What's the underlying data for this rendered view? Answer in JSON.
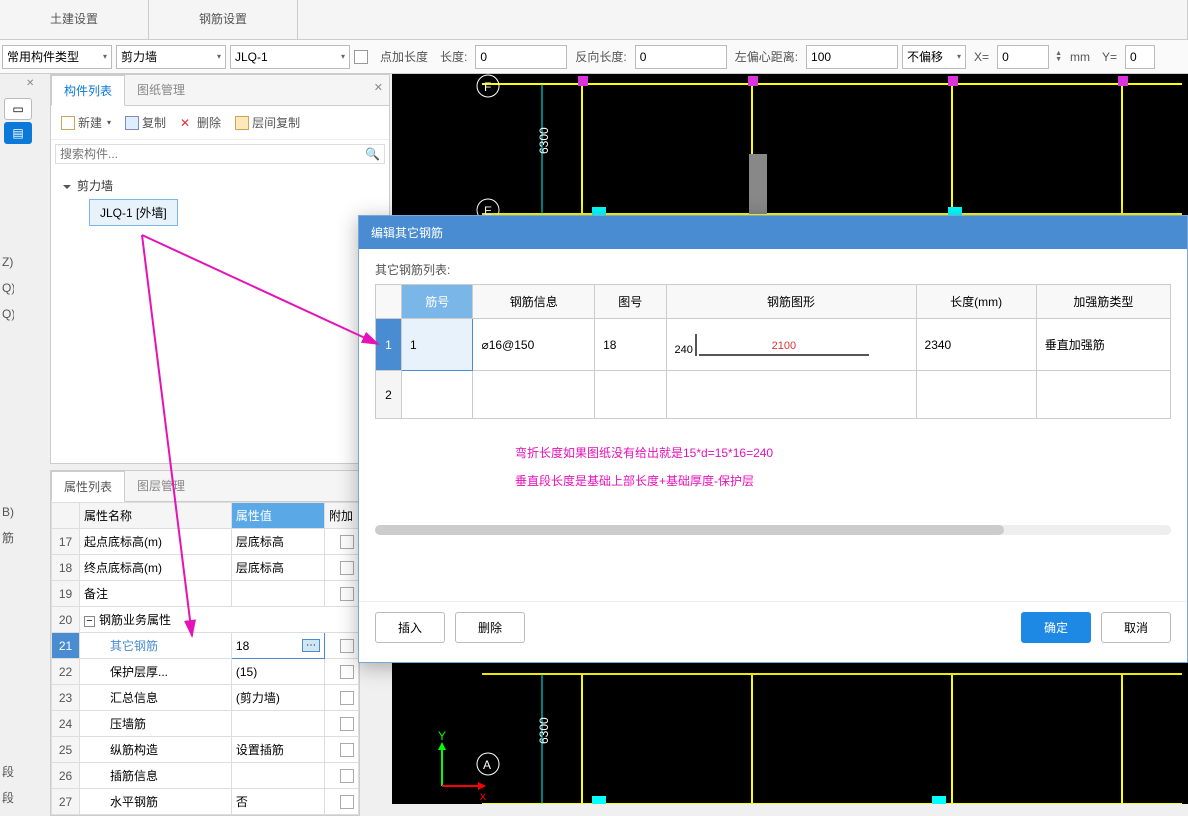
{
  "topbar": {
    "tabs": [
      "土建设置",
      "钢筋设置"
    ]
  },
  "params": {
    "type_label": "常用构件类型",
    "combo1": "剪力墙",
    "combo2": "JLQ-1",
    "pt_len_label": "点加长度",
    "len_label": "长度:",
    "len_val": "0",
    "rev_label": "反向长度:",
    "rev_val": "0",
    "left_ecc_label": "左偏心距离:",
    "left_ecc_val": "100",
    "offset_combo": "不偏移",
    "x_label": "X=",
    "x_val": "0",
    "mm_label": "mm",
    "y_label": "Y=",
    "y_val": "0"
  },
  "side_items": [
    "Z)",
    "Q)",
    "Q)",
    "B)",
    "筋(S)",
    "段(R)",
    "段(R)"
  ],
  "panel": {
    "tabs": [
      "构件列表",
      "图纸管理"
    ],
    "btn_new": "新建",
    "btn_copy": "复制",
    "btn_del": "删除",
    "btn_floor": "层间复制",
    "search_ph": "搜索构件...",
    "search_icon": "🔍",
    "tree_root": "剪力墙",
    "tree_child": "JLQ-1 [外墙]"
  },
  "props": {
    "tabs": [
      "属性列表",
      "图层管理"
    ],
    "hdr_name": "属性名称",
    "hdr_val": "属性值",
    "hdr_extra": "附加",
    "rows": [
      {
        "n": "17",
        "name": "起点底标高(m)",
        "val": "层底标高"
      },
      {
        "n": "18",
        "name": "终点底标高(m)",
        "val": "层底标高"
      },
      {
        "n": "19",
        "name": "备注",
        "val": ""
      },
      {
        "n": "20",
        "name": "钢筋业务属性",
        "val": "",
        "group": true
      },
      {
        "n": "21",
        "name": "其它钢筋",
        "val": "18",
        "sel": true
      },
      {
        "n": "22",
        "name": "保护层厚...",
        "val": "(15)"
      },
      {
        "n": "23",
        "name": "汇总信息",
        "val": "(剪力墙)"
      },
      {
        "n": "24",
        "name": "压墙筋",
        "val": ""
      },
      {
        "n": "25",
        "name": "纵筋构造",
        "val": "设置插筋"
      },
      {
        "n": "26",
        "name": "插筋信息",
        "val": ""
      },
      {
        "n": "27",
        "name": "水平钢筋",
        "val": "否"
      }
    ]
  },
  "cad": {
    "dim": "6300",
    "axis_f": "F",
    "axis_e": "E",
    "axis_a": "A",
    "axis_y": "Y",
    "axis_x": "x"
  },
  "dialog": {
    "title": "编辑其它钢筋",
    "list_label": "其它钢筋列表:",
    "headers": [
      "筋号",
      "钢筋信息",
      "图号",
      "钢筋图形",
      "长度(mm)",
      "加强筋类型"
    ],
    "row1": {
      "n": "1",
      "no": "1",
      "info": "⌀16@150",
      "fig": "18",
      "shape_l": "240",
      "shape_t": "2100",
      "len": "2340",
      "kind": "垂直加强筋"
    },
    "row2_n": "2",
    "hint_line1": "弯折长度如果图纸没有给出就是15*d=15*16=240",
    "hint_line2": "垂直段长度是基础上部长度+基础厚度-保护层",
    "btn_insert": "插入",
    "btn_delete": "删除",
    "btn_ok": "确定",
    "btn_cancel": "取消"
  }
}
